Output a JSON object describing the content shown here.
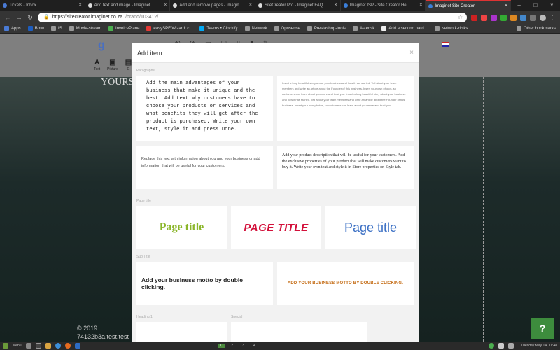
{
  "browser": {
    "tabs": [
      {
        "title": "Tickets - Inbox",
        "active": false
      },
      {
        "title": "Add text and image - Imaginet",
        "active": false
      },
      {
        "title": "Add and remove pages - Imagin",
        "active": false
      },
      {
        "title": "SiteCreator Pro - Imaginet FAQ",
        "active": false
      },
      {
        "title": "Imaginet ISP - Site Creator Hel",
        "active": false
      },
      {
        "title": "Imaginet Site Creator",
        "active": true
      }
    ],
    "url_domain": "https://sitecreator.imaginet.co.za",
    "url_path": "/brand/103412/",
    "bookmarks": [
      "Apps",
      "Bmw",
      "IS",
      "Movie-stream",
      "InvoicePlane",
      "easySPF Wizard: c...",
      "Teams • Clockify",
      "Network",
      "Opnsense",
      "Prestashop-tools",
      "Asterisk",
      "Add a second hard...",
      "Network-disks"
    ],
    "other_bookmarks": "Other bookmarks"
  },
  "editor": {
    "logo_letter": "g",
    "tools": [
      "Text",
      "Picture",
      "G"
    ],
    "hero_text": "YOURS",
    "copyright": "© 2019",
    "site_sub": "74132b3a.test.test",
    "help": "?"
  },
  "modal": {
    "title": "Add item",
    "close": "×",
    "sections": {
      "paragraphs": "Paragraphs",
      "page_title": "Page title",
      "sub_title": "Sub Title",
      "heading": "Heading 1",
      "special": "Special"
    },
    "paragraphs": [
      "Add the main advantages of your business that make it unique and the best. Add text why customers have to choose your products or services and what benefits they will get after the product is purchased. Write your own text, style it and press Done.",
      "Insert a long beautiful story about your business and how it has started. Tell about your team members and write an article about the Founder of this business. Insert your own photos, so customers can learn about you more and trust you. Insert a long beautiful story about your business and how it has started. Tell about your team members and write an article about the Founder of this business. Insert your own photos, so customers can learn about you more and trust you.",
      "Replace this text with information about you and your business or add information that will be useful for your customers.",
      "Add your product description that will be useful for your customers. Add the exclusive properties of your product that will make customers want to buy it. Write your own text and style it in Store properties on Style tab."
    ],
    "page_titles": [
      "Page title",
      "PAGE TITLE",
      "Page title"
    ],
    "sub_titles": [
      "Add your business motto by double clicking.",
      "ADD YOUR BUSINESS MOTTO BY DOUBLE CLICKING."
    ]
  },
  "taskbar": {
    "menu": "Menu",
    "workspaces": [
      "1",
      "2",
      "3",
      "4"
    ],
    "clock": "Tuesday May 14, 11:48"
  }
}
